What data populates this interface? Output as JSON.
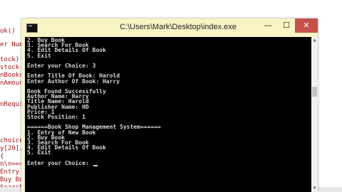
{
  "editor": {
    "code_lines": [
      "ok()",
      "er Numb",
      "tock)",
      "stock-c",
      "nBooks",
      "nAmount",
      "nRequir",
      "choice;",
      "y[20],a",
      "{",
      "n\\n====",
      "Entry o",
      "Buy Book\"",
      "Search For Book\""
    ]
  },
  "window": {
    "title": "C:\\Users\\Mark\\Desktop\\index.exe",
    "minimize": "—",
    "maximize": "☐",
    "close": "✕"
  },
  "console": {
    "lines": [
      "2. Buy Book",
      "3. Search For Book",
      "4. Edit Details Of Book",
      "5. Exit",
      "",
      "Enter your Choice: 3",
      "",
      "Enter Title Of Book: Harold",
      "Enter Author Of Book: Harry",
      "",
      "Book Found Successfully",
      "Author Name: Harry",
      "Title Name: Harold",
      "Publisher Name: HD",
      "Price: 1",
      "Stock Position: 1",
      "",
      "======Book Shop Management System======",
      "1. Entry of New Book",
      "2. Buy Book",
      "3. Search For Book",
      "4. Edit Details Of Book",
      "5. Exit",
      "",
      "Enter your Choice: "
    ]
  },
  "scroll": {
    "up": "▲",
    "down": "▼"
  }
}
